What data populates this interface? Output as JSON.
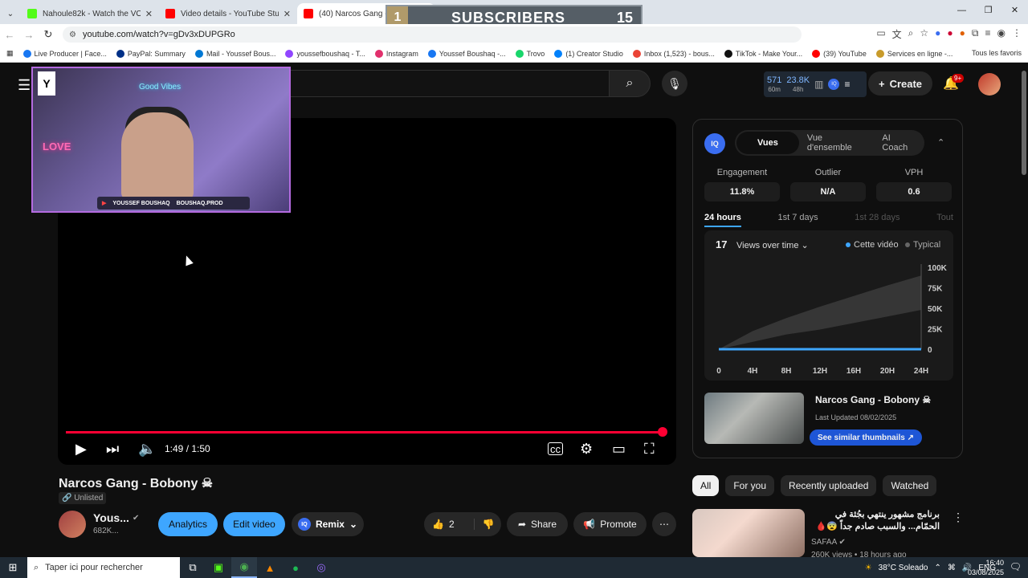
{
  "browser": {
    "tabs": [
      {
        "title": "Nahoule82k - Watch the VOD o",
        "color": "#53fc18"
      },
      {
        "title": "Video details - YouTube Studio",
        "color": "#ff0000"
      },
      {
        "title": "(40) Narcos Gang - Bobony ☠",
        "color": "#ff0000"
      }
    ],
    "url": "youtube.com/watch?v=gDv3xDUPGRo",
    "bookmarks": [
      {
        "label": "Live Producer | Face...",
        "color": "#1877f2"
      },
      {
        "label": "PayPal: Summary",
        "color": "#003087"
      },
      {
        "label": "Mail - Youssef Bous...",
        "color": "#0078d4"
      },
      {
        "label": "youssefboushaq - T...",
        "color": "#9146ff"
      },
      {
        "label": "Instagram",
        "color": "#e1306c"
      },
      {
        "label": "Youssef Boushaq -...",
        "color": "#1877f2"
      },
      {
        "label": "Trovo",
        "color": "#19d66b"
      },
      {
        "label": "(1) Creator Studio",
        "color": "#0081fb"
      },
      {
        "label": "Inbox (1,523) - bous...",
        "color": "#ea4335"
      },
      {
        "label": "TikTok - Make Your...",
        "color": "#111111"
      },
      {
        "label": "(39) YouTube",
        "color": "#ff0000"
      },
      {
        "label": "Services en ligne -...",
        "color": "#c89b2b"
      }
    ],
    "bookmarks_end": "Tous les favoris"
  },
  "overlay": {
    "rank": "1",
    "label": "SUBSCRIBERS",
    "count": "15"
  },
  "webcam": {
    "neon_text": "Good Vibes",
    "love": "LOVE",
    "banner_name": "YOUSSEF BOUSHAQ",
    "banner_handle": "BOUSHAQ.PROD",
    "logo": "Y"
  },
  "header": {
    "stat1_value": "571",
    "stat1_label": "60m",
    "stat2_value": "23.8K",
    "stat2_label": "48h",
    "iq_label": "IQ",
    "create_label": "Create",
    "notif_count": "9+"
  },
  "player": {
    "time": "1:49 / 1:50",
    "progress": 0.99
  },
  "video": {
    "title": "Narcos Gang - Bobony ☠",
    "visibility": "Unlisted",
    "channel": "Yous...",
    "subs": "682K...",
    "analytics": "Analytics",
    "edit": "Edit video",
    "remix": "Remix",
    "likes": "2",
    "share": "Share",
    "promote": "Promote"
  },
  "panel": {
    "iq": "IQ",
    "tabs": [
      "Vues",
      "Vue d'ensemble",
      "AI Coach"
    ],
    "metrics": [
      {
        "label": "Engagement",
        "value": "11.8%"
      },
      {
        "label": "Outlier",
        "value": "N/A"
      },
      {
        "label": "VPH",
        "value": "0.6"
      }
    ],
    "periods": [
      "24 hours",
      "1st 7 days",
      "1st 28 days",
      "Tout"
    ],
    "chart_count": "17",
    "chart_select": "Views over time",
    "legend_this": "Cette vidéo",
    "legend_typical": "Typical",
    "colors": {
      "this": "#3ea6ff",
      "typical": "#666666"
    },
    "video_title": "Narcos Gang - Bobony ☠",
    "last_updated": "Last Updated 08/02/2025",
    "thumb_button": "See similar thumbnails"
  },
  "chart_data": {
    "type": "area",
    "x": [
      "0",
      "4H",
      "8H",
      "12H",
      "16H",
      "20H",
      "24H"
    ],
    "y_ticks": [
      "0",
      "25K",
      "50K",
      "75K",
      "100K"
    ],
    "ylim": [
      0,
      100000
    ],
    "series": [
      {
        "name": "Cette vidéo",
        "values": [
          17,
          17,
          17,
          17,
          17,
          17,
          17
        ]
      },
      {
        "name": "Typical",
        "range_low": [
          0,
          9000,
          18000,
          24000,
          32000,
          40000,
          48000
        ],
        "range_high": [
          0,
          22000,
          38000,
          52000,
          65000,
          78000,
          90000
        ]
      }
    ]
  },
  "chips": [
    "All",
    "For you",
    "Recently uploaded",
    "Watched"
  ],
  "recommendation": {
    "title": "برنامج مشهور ينتهي بجُثة في الحمّام... والسبب صادم جداً 😨🩸",
    "channel": "SAFAA",
    "meta": "260K views • 18 hours ago"
  },
  "taskbar": {
    "search_placeholder": "Taper ici pour rechercher",
    "weather": "38°C  Soleado",
    "lang": "ENG",
    "time": "16:40",
    "date": "03/08/2025"
  }
}
